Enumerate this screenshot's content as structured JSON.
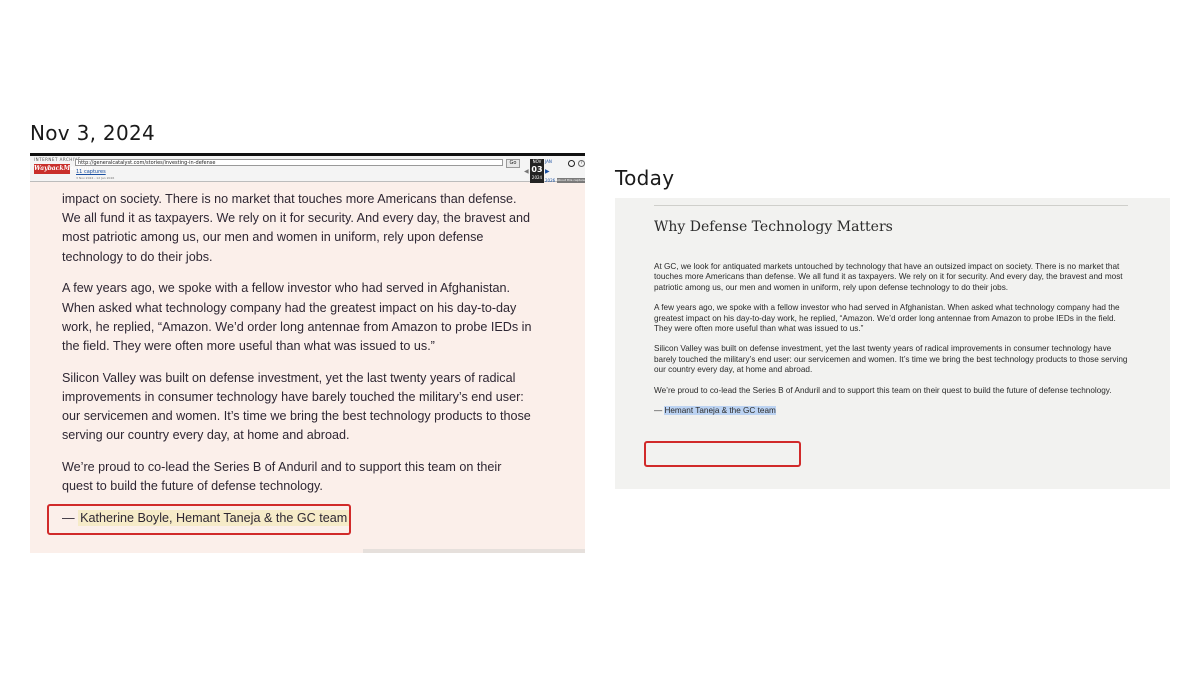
{
  "labels": {
    "archived_date": "Nov 3, 2024",
    "today": "Today"
  },
  "wayback_toolbar": {
    "logo_top": "INTERNET ARCHIVE",
    "logo": "WaybackMachine",
    "url": "http://generalcatalyst.com/stories/investing-in-defense",
    "go_label": "Go",
    "captures": "11 captures",
    "capture_range": "3 Nov 2024 - 12 Jan 2026",
    "prev_month": "NOV",
    "current_day": "03",
    "current_year": "2024",
    "next_month": "JAN",
    "next_year": "2026",
    "about_label": "About this capture",
    "accent_color": "#c9302c"
  },
  "archived_article": {
    "paragraphs": [
      "impact on society. There is no market that touches more Americans than defense. We all fund it as taxpayers. We rely on it for security. And every day, the bravest and most patriotic among us, our men and women in uniform, rely upon defense technology to do their jobs.",
      "A few years ago, we spoke with a fellow investor who had served in Afghanistan. When asked what technology company had the greatest impact on his day-to-day work, he replied, “Amazon. We’d order long antennae from Amazon to probe IEDs in the field. They were often more useful than what was issued to us.”",
      "Silicon Valley was built on defense investment, yet the last twenty years of radical improvements in consumer technology have barely touched the military’s end user: our servicemen and women. It’s time we bring the best technology products to those serving our country every day, at home and abroad.",
      "We’re proud to co-lead the Series B of Anduril and to support this team on their quest to build the future of defense technology."
    ],
    "signature_dash": "—",
    "signature": "Katherine Boyle, Hemant Taneja & the GC team"
  },
  "current_article": {
    "heading": "Why Defense Technology Matters",
    "paragraphs": [
      "At GC, we look for antiquated markets untouched by technology that have an outsized impact on society. There is no market that touches more Americans than defense. We all fund it as taxpayers. We rely on it for security. And every day, the bravest and most patriotic among us, our men and women in uniform, rely upon defense technology to do their jobs.",
      "A few years ago, we spoke with a fellow investor who had served in Afghanistan. When asked what technology company had the greatest impact on his day-to-day work, he replied, “Amazon. We’d order long antennae from Amazon to probe IEDs in the field. They were often more useful than what was issued to us.”",
      "Silicon Valley was built on defense investment, yet the last twenty years of radical improvements in consumer technology have barely touched the military’s end user: our servicemen and women. It’s time we bring the best technology products to those serving our country every day, at home and abroad.",
      "We’re proud to co-lead the Series B of Anduril and to support this team on their quest to build the future of defense technology."
    ],
    "signature_dash": "—",
    "signature": "Hemant Taneja & the GC team"
  },
  "colors": {
    "highlight_box": "#d12a2a",
    "archived_background": "#fbefea",
    "current_background": "#f2f2f0",
    "selection_highlight": "#bcd3f2"
  }
}
